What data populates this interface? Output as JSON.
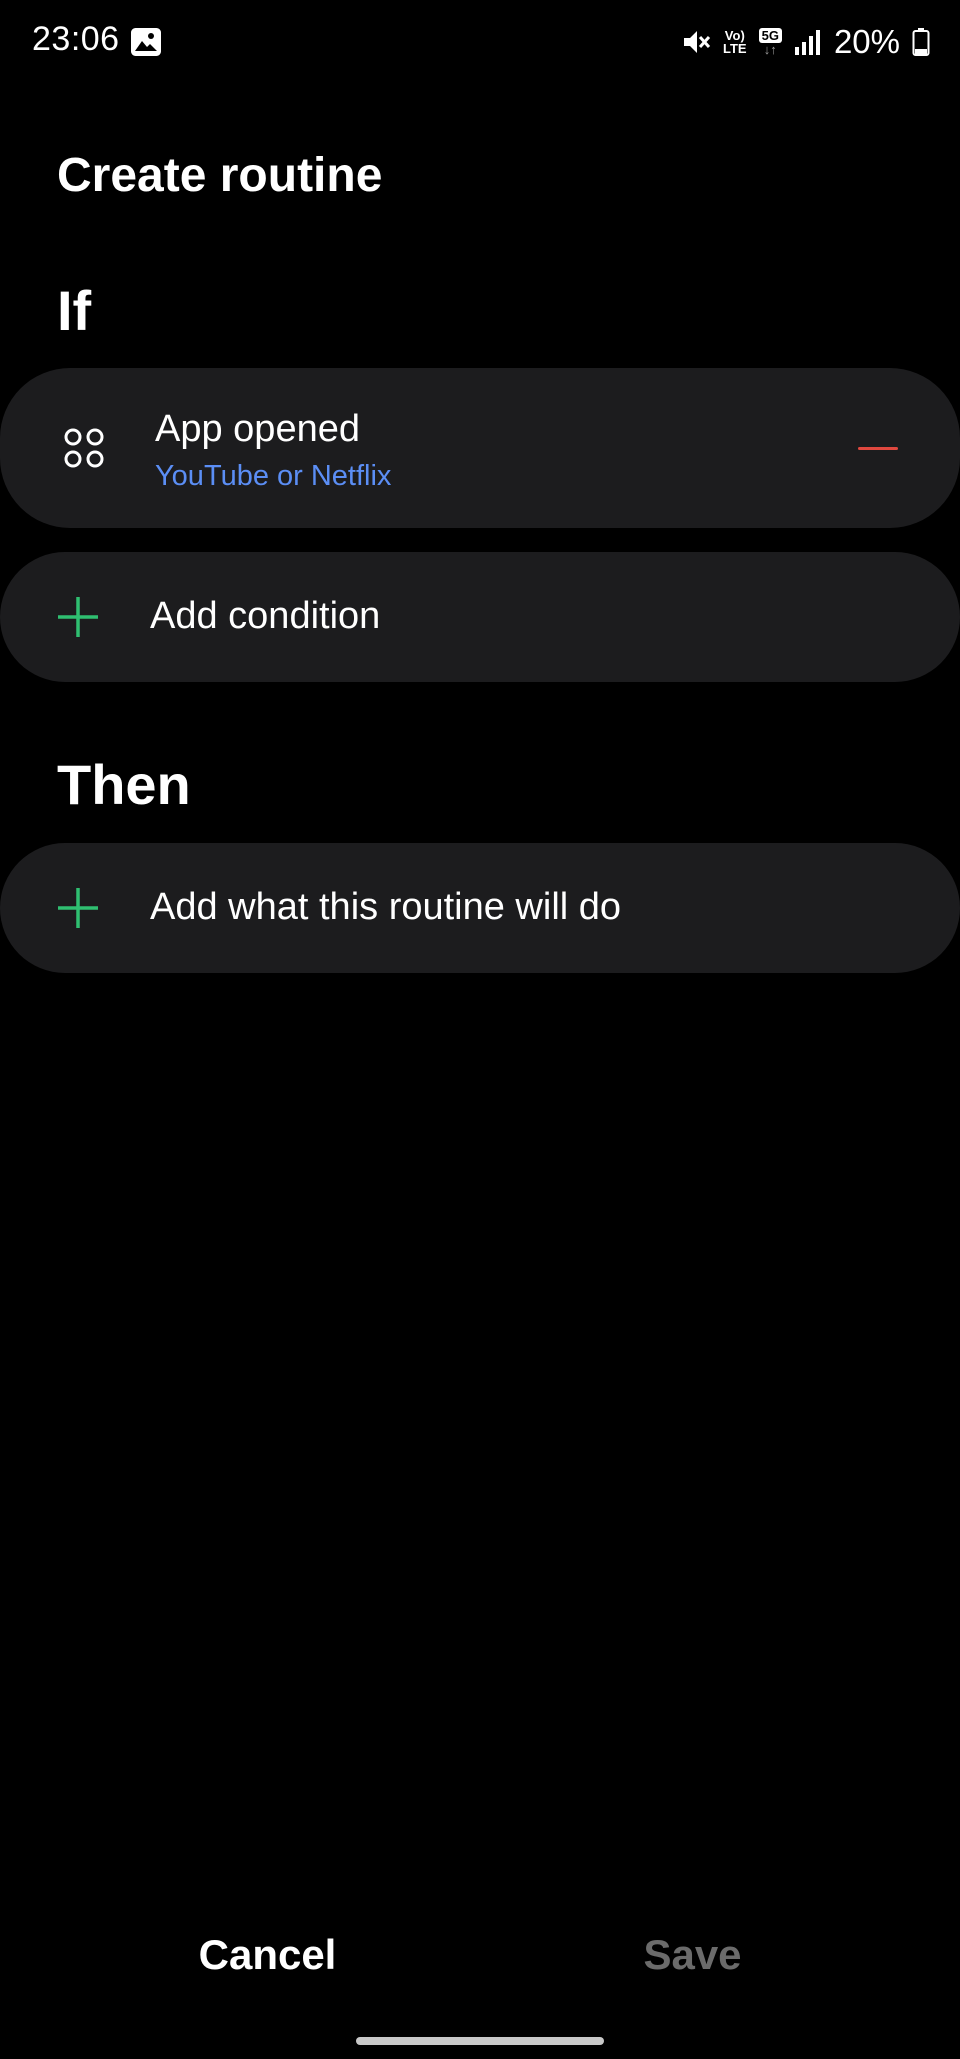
{
  "status_bar": {
    "time": "23:06",
    "battery_percent": "20%",
    "network_label": "5G",
    "volte_top": "Vo)",
    "volte_bottom": "LTE",
    "icons": [
      "gallery-icon",
      "mute-icon",
      "volte-icon",
      "5g-icon",
      "signal-icon",
      "battery-icon"
    ]
  },
  "page": {
    "title": "Create routine"
  },
  "if_section": {
    "heading": "If",
    "condition": {
      "title": "App opened",
      "subtitle": "YouTube or Netflix",
      "icon": "apps-icon"
    },
    "add_label": "Add condition"
  },
  "then_section": {
    "heading": "Then",
    "add_label": "Add what this routine will do"
  },
  "footer": {
    "cancel_label": "Cancel",
    "save_label": "Save"
  },
  "colors": {
    "background": "#000000",
    "card": "#1c1c1e",
    "accent_link": "#5b8ef5",
    "remove": "#e0483f",
    "add": "#2fbf71",
    "disabled": "#6b6b6b"
  }
}
